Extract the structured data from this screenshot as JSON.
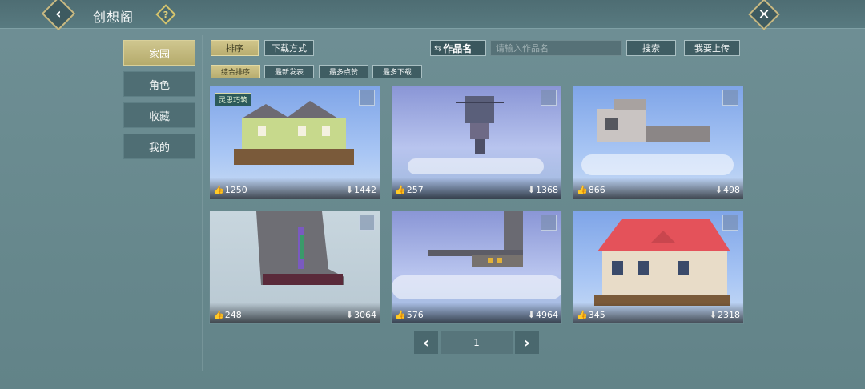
{
  "window": {
    "title": "创想阁"
  },
  "icons": {
    "back": "chevron-left-icon",
    "help": "question-icon",
    "close": "close-icon",
    "like": "thumbs-up-icon",
    "download": "download-arrow-icon"
  },
  "sidebar": {
    "items": [
      {
        "label": "家园",
        "active": true
      },
      {
        "label": "角色",
        "active": false
      },
      {
        "label": "收藏",
        "active": false
      },
      {
        "label": "我的",
        "active": false
      }
    ]
  },
  "toolbar": {
    "sort_label": "排序",
    "download_mode_label": "下载方式",
    "search_field_label": "作品名",
    "search_placeholder": "请输入作品名",
    "search_button": "搜索",
    "upload_button": "我要上传"
  },
  "filters": {
    "options": [
      "综合排序",
      "最新发表",
      "最多点赞",
      "最多下载"
    ],
    "selected": "综合排序"
  },
  "cards": [
    {
      "likes": "1250",
      "downloads": "1442",
      "badge": "灵思巧筑"
    },
    {
      "likes": "257",
      "downloads": "1368"
    },
    {
      "likes": "866",
      "downloads": "498"
    },
    {
      "likes": "248",
      "downloads": "3064"
    },
    {
      "likes": "576",
      "downloads": "4964"
    },
    {
      "likes": "345",
      "downloads": "2318"
    }
  ],
  "pagination": {
    "current": "1"
  },
  "colors": {
    "accent_gold": "#cfc68f",
    "panel": "#4f6e74",
    "background": "#6a8b90"
  }
}
